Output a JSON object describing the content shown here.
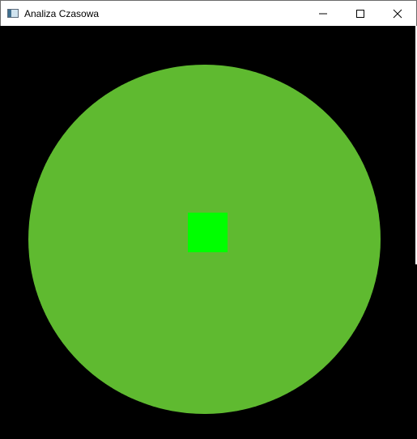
{
  "window": {
    "title": "Analiza Czasowa",
    "icons": {
      "app": "app-window-icon",
      "minimize": "minimize-icon",
      "maximize": "maximize-icon",
      "close": "close-icon"
    }
  },
  "scene": {
    "background_color": "#000000",
    "glow_color": "#66c834",
    "core_color": "#00ff00"
  }
}
